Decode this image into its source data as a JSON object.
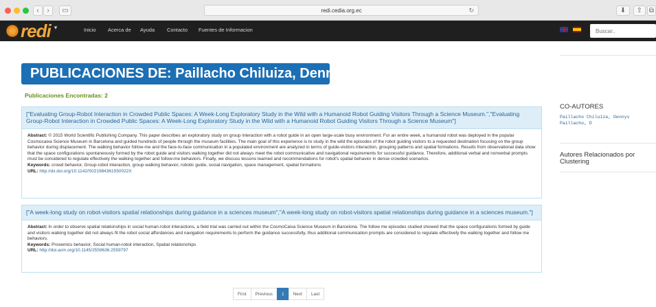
{
  "browser": {
    "url": "redi.cedia.org.ec",
    "back_glyph": "‹",
    "forward_glyph": "›",
    "sidebar_glyph": "▭",
    "reload_glyph": "↻",
    "download_glyph": "⬇",
    "share_glyph": "⇧",
    "tabs_glyph": "⧉"
  },
  "navbar": {
    "logo_text": "redi",
    "menu_caret": "▾",
    "links": [
      "Inicio",
      "Acerca de",
      "Ayuda",
      "Contacto",
      "Fuentes de Informacion"
    ],
    "search_placeholder": "Buscar.."
  },
  "page": {
    "title": "PUBLICACIONES DE: Paillacho Chiluiza, Dennys",
    "found_label": "Publicaciones Encontradas: 2"
  },
  "publications": [
    {
      "title": "[\"Evaluating Group-Robot Interaction in Crowded Public Spaces: A Week-Long Exploratory Study in the Wild with a Humanoid Robot Guiding Visitors Through a Science Museum.\",\"Evaluating Group-Robot Interaction in Crowded Public Spaces: A Week-Long Exploratory Study in the Wild with a Humanoid Robot Guiding Visitors Through a Science Museum\"]",
      "abstract_label": "Abstract:",
      "abstract": "© 2015 World Scientific Publishing Company. This paper describes an exploratory study on group interaction with a robot guide in an open large-scale busy environment. For an entire week, a humanoid robot was deployed in the popular Cosmocaixa Science Museum in Barcelona and guided hundreds of people through the museum facilities. The main goal of this experience is to study in the wild the episodes of the robot guiding visitors to a requested destination focusing on the group behavior during displacement. The walking behavior follow-me and the face-to-face communication in a populated environment are analyzed in terms of guide-visitors interaction, grouping patterns and spatial formations. Results from observational data show that the space configurations spontaneously formed by the robot guide and visitors walking together did not always meet the robot communicative and navigational requirements for successful guidance. Therefore, additional verbal and nonverbal prompts must be considered to regulate effectively the walking together and follow-me behaviors. Finally, we discuss lessons learned and recommendations for robot's spatial behavior in dense crowded scenarios.",
      "keywords_label": "Keywords:",
      "keywords": "crowd behavior, Group-robot interaction, group walking behavior, robotic guide, social navigation, space management, spatial formations",
      "url_label": "URL:",
      "url": "http://dx.doi.org/10.1142/S021984361550022X"
    },
    {
      "title": "[\"A week-long study on robot-visitors spatial relationships during guidance in a sciences museum\",\"A week-long study on robot-visitors spatial relationships during guidance in a sciences museum.\"]",
      "abstract_label": "Abstract:",
      "abstract": "In order to observe spatial relationships in social human-robot interactions, a field trial was carried out within the CosmoCaixa Science Museum in Barcelona. The follow me episodes studied showed that the space configurations formed by guide and visitors walking together did not always fit the robot social affordances and navigation requirements to perform the guidance successfully, thus additional communication prompts are considered to regulate effectively the walking together and follow me behaviors.",
      "keywords_label": "Keywords:",
      "keywords": "Proxemics behavior, Social human-robot interaction, Spatial relationships",
      "url_label": "URL:",
      "url": "http://doi.acm.org/10.1145/2559636.2559797"
    }
  ],
  "sidebar": {
    "coauthors_title": "CO-AUTORES",
    "coauthors": [
      "Paillacho Chiluiza, Dennys",
      "Paillacho, D"
    ],
    "related_title": "Autores Relacionados por Clustering"
  },
  "pagination": [
    "First",
    "Previous",
    "1",
    "Next",
    "Last"
  ],
  "colors": {
    "title_bg": "#1c6fb4",
    "found_green": "#6a8d17",
    "link_blue": "#2a6496",
    "panel_head_bg": "#ddeef8",
    "navbar_bg": "#1f1f1f",
    "logo_orange": "#f0a93c"
  }
}
